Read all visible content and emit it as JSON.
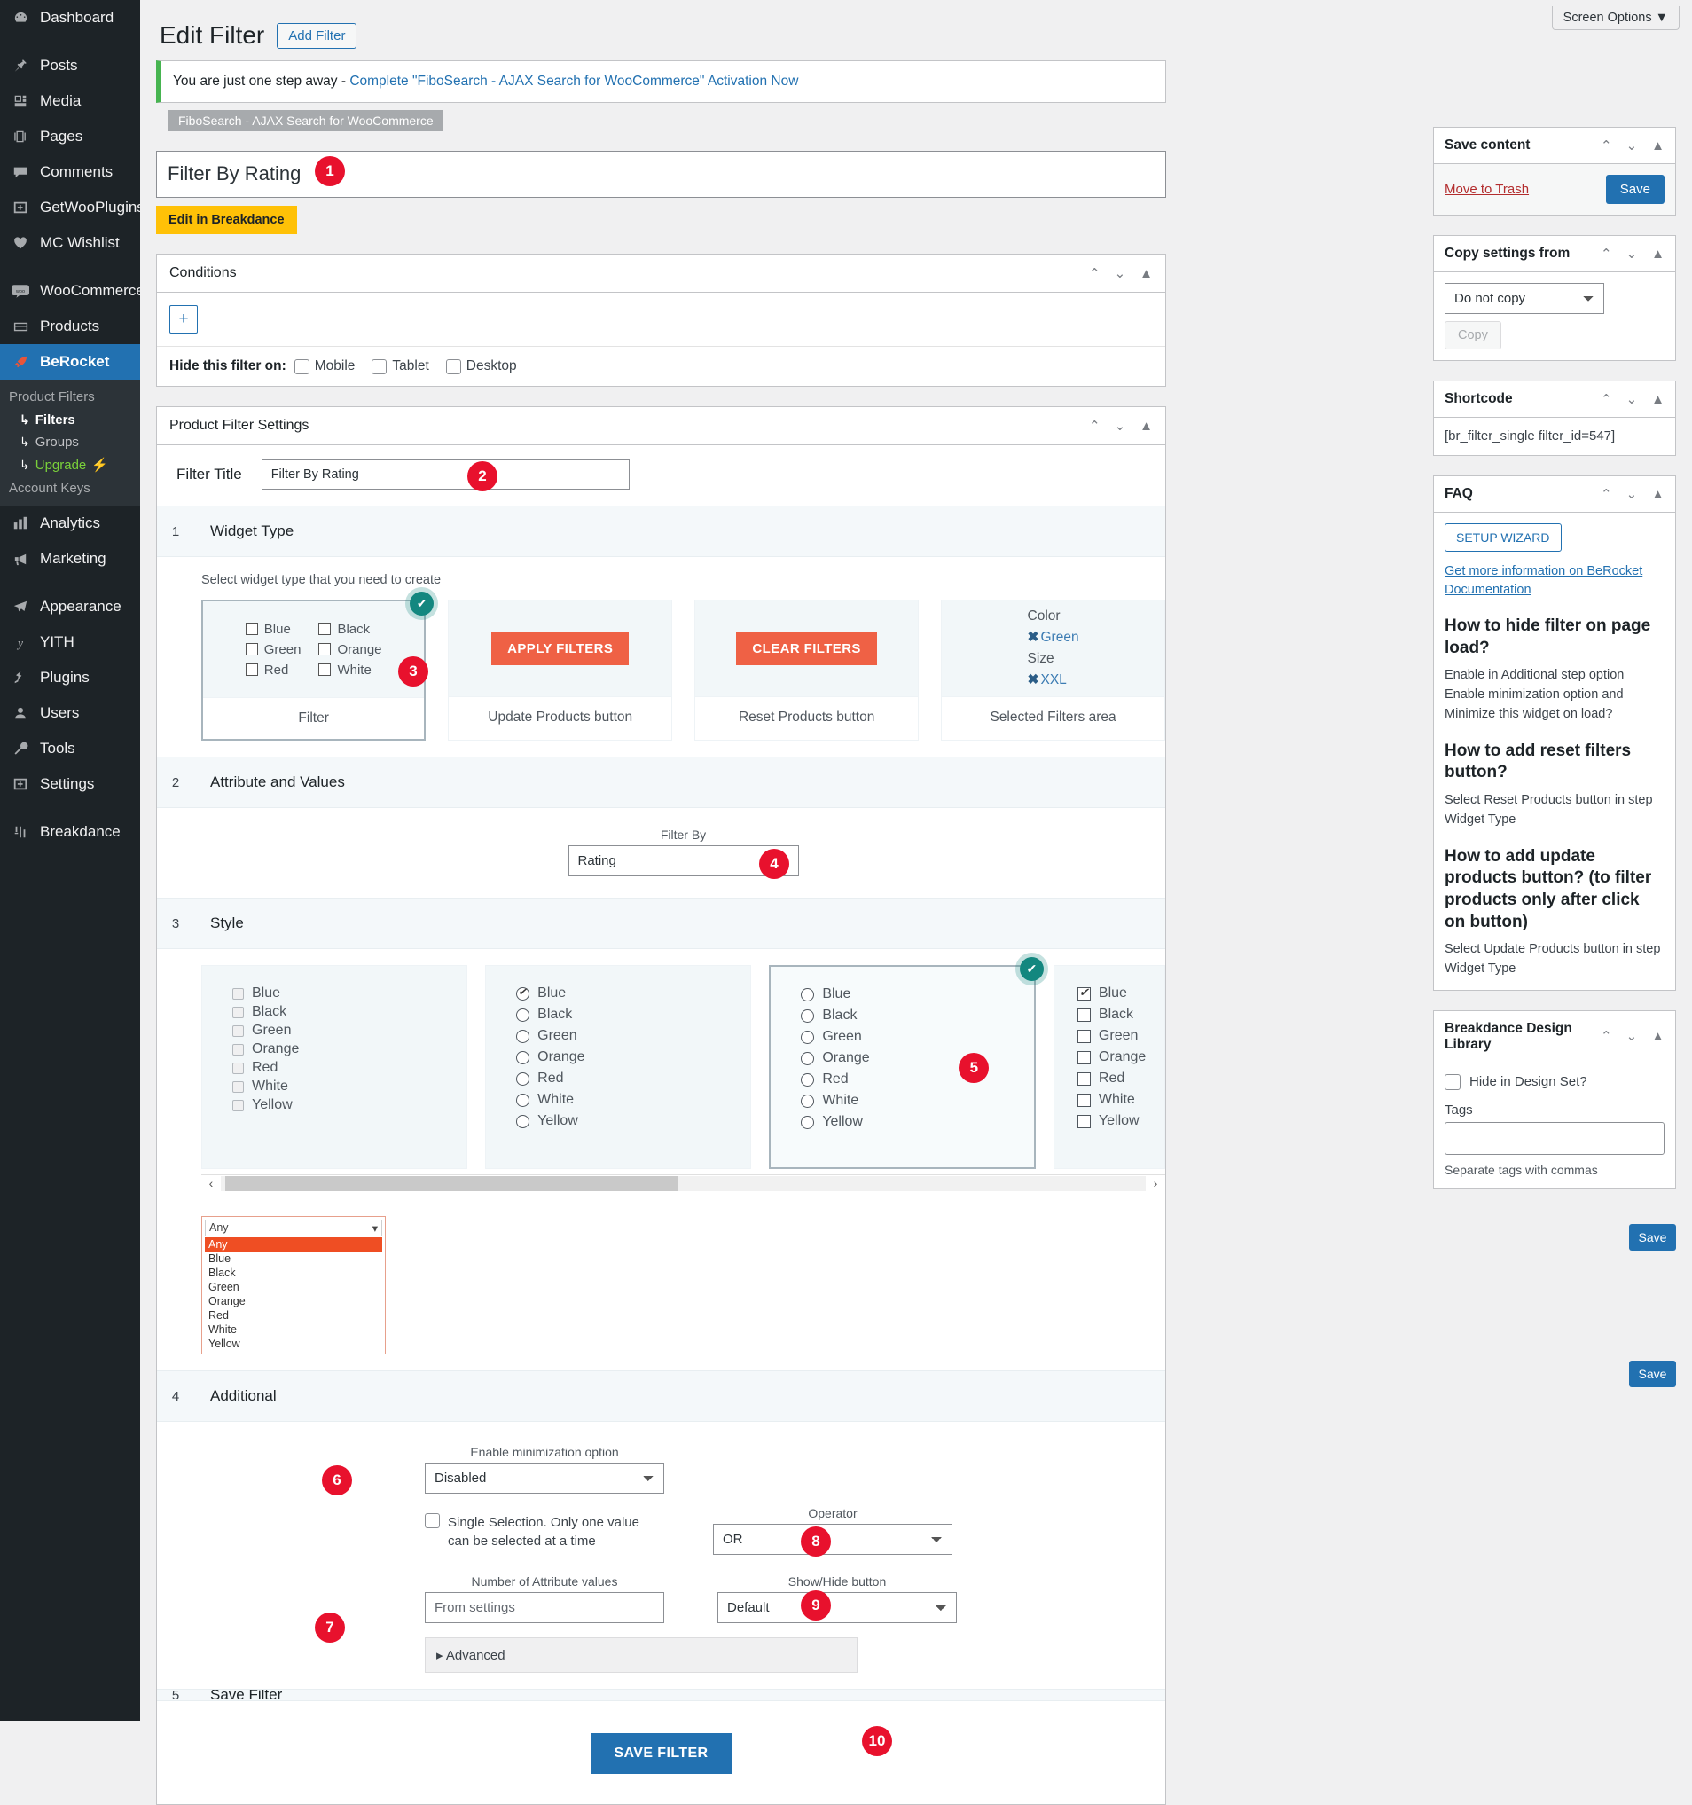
{
  "sidebar": {
    "items": [
      {
        "label": "Dashboard",
        "icon": "dashboard-icon"
      },
      {
        "label": "Posts",
        "icon": "pin-icon"
      },
      {
        "label": "Media",
        "icon": "media-icon"
      },
      {
        "label": "Pages",
        "icon": "pages-icon"
      },
      {
        "label": "Comments",
        "icon": "comments-icon"
      },
      {
        "label": "GetWooPlugins",
        "icon": "plugin-icon"
      },
      {
        "label": "MC Wishlist",
        "icon": "heart-icon"
      },
      {
        "label": "WooCommerce",
        "icon": "woo-icon"
      },
      {
        "label": "Products",
        "icon": "products-icon"
      },
      {
        "label": "BeRocket",
        "icon": "rocket-icon"
      }
    ],
    "submenu": {
      "heading": "Product Filters",
      "items": [
        {
          "label": "Filters",
          "state": "active"
        },
        {
          "label": "Groups",
          "state": "normal"
        },
        {
          "label": "Upgrade",
          "state": "upgrade",
          "suffix": "⚡"
        }
      ],
      "footer": "Account Keys"
    },
    "items_after": [
      {
        "label": "Analytics",
        "icon": "analytics-icon"
      },
      {
        "label": "Marketing",
        "icon": "marketing-icon"
      },
      {
        "label": "Appearance",
        "icon": "appearance-icon"
      },
      {
        "label": "YITH",
        "icon": "yith-icon"
      },
      {
        "label": "Plugins",
        "icon": "plugins-icon"
      },
      {
        "label": "Users",
        "icon": "users-icon"
      },
      {
        "label": "Tools",
        "icon": "tools-icon"
      },
      {
        "label": "Settings",
        "icon": "settings-icon"
      },
      {
        "label": "Breakdance",
        "icon": "breakdance-icon"
      }
    ]
  },
  "header": {
    "screen_options": "Screen Options ▼",
    "title": "Edit Filter",
    "add_filter": "Add Filter"
  },
  "notice": {
    "text": "You are just one step away - ",
    "link": "Complete \"FiboSearch - AJAX Search for WooCommerce\" Activation Now",
    "chip": "FiboSearch - AJAX Search for WooCommerce"
  },
  "title_field": {
    "value": "Filter By Rating",
    "breakdance_button": "Edit in Breakdance"
  },
  "conditions": {
    "heading": "Conditions",
    "add_label": "+",
    "hide_label": "Hide this filter on:",
    "devices": [
      "Mobile",
      "Tablet",
      "Desktop"
    ]
  },
  "settings": {
    "heading": "Product Filter Settings",
    "filter_title_label": "Filter Title",
    "filter_title_value": "Filter By Rating"
  },
  "steps": {
    "widget_type": {
      "num": "1",
      "title": "Widget Type",
      "hint": "Select widget type that you need to create",
      "cards": [
        {
          "caption": "Filter",
          "type": "checkbox-grid",
          "selected": true,
          "options": [
            "Blue",
            "Black",
            "Green",
            "Orange",
            "Red",
            "White"
          ]
        },
        {
          "caption": "Update Products button",
          "type": "button",
          "button_label": "APPLY FILTERS",
          "selected": false
        },
        {
          "caption": "Reset Products button",
          "type": "button",
          "button_label": "CLEAR FILTERS",
          "selected": false
        },
        {
          "caption": "Selected Filters area",
          "type": "selected-filters",
          "selected": false,
          "groups": [
            {
              "name": "Color",
              "chip": "Green"
            },
            {
              "name": "Size",
              "chip": "XXL"
            }
          ],
          "remove_glyph": "✖"
        }
      ]
    },
    "attribute": {
      "num": "2",
      "title": "Attribute and Values",
      "filter_by_label": "Filter By",
      "filter_by_value": "Rating",
      "filter_by_options": [
        "Rating"
      ]
    },
    "style": {
      "num": "3",
      "title": "Style",
      "options": [
        "Blue",
        "Black",
        "Green",
        "Orange",
        "Red",
        "White",
        "Yellow"
      ],
      "cards": [
        {
          "kind": "flat-checkbox",
          "selected": false,
          "checked_index": -1
        },
        {
          "kind": "radio-check",
          "selected": false,
          "checked_index": 0
        },
        {
          "kind": "radio",
          "selected": true,
          "checked_index": -1
        },
        {
          "kind": "checkbox",
          "selected": false,
          "checked_index": 0
        }
      ],
      "dropdown_preview": {
        "selected": "Any",
        "caret": "▾",
        "items": [
          "Any",
          "Blue",
          "Black",
          "Green",
          "Orange",
          "Red",
          "White",
          "Yellow"
        ],
        "highlight_index": 0
      }
    },
    "additional": {
      "num": "4",
      "title": "Additional",
      "minimization_label": "Enable minimization option",
      "minimization_value": "Disabled",
      "minimization_options": [
        "Disabled"
      ],
      "single_selection_text": "Single Selection. Only one value can be selected at a time",
      "operator_label": "Operator",
      "operator_value": "OR",
      "operator_options": [
        "OR"
      ],
      "number_values_label": "Number of Attribute values",
      "number_values_placeholder": "From settings",
      "number_values_value": "",
      "showhide_label": "Show/Hide button",
      "showhide_value": "Default",
      "showhide_options": [
        "Default"
      ],
      "advanced_label": "Advanced",
      "advanced_caret": "▸"
    },
    "save": {
      "num": "5",
      "title": "Save Filter",
      "button": "SAVE FILTER"
    }
  },
  "badges": [
    "1",
    "2",
    "3",
    "4",
    "5",
    "6",
    "7",
    "8",
    "9",
    "10"
  ],
  "sidebar_panels": {
    "save_content": {
      "title": "Save content",
      "trash": "Move to Trash",
      "save": "Save"
    },
    "copy_settings": {
      "title": "Copy settings from",
      "value": "Do not copy",
      "options": [
        "Do not copy"
      ],
      "copy_button": "Copy"
    },
    "shortcode": {
      "title": "Shortcode",
      "value": "[br_filter_single filter_id=547]"
    },
    "faq": {
      "title": "FAQ",
      "wizard_button": "SETUP WIZARD",
      "doc_link": "Get more information on BeRocket Documentation",
      "entries": [
        {
          "q": "How to hide filter on page load?",
          "a": "Enable in Additional step option Enable minimization option and Minimize this widget on load?"
        },
        {
          "q": "How to add reset filters button?",
          "a": "Select Reset Products button in step Widget Type"
        },
        {
          "q": "How to add update products button? (to filter products only after click on button)",
          "a": "Select Update Products button in step Widget Type"
        }
      ]
    },
    "design_library": {
      "title": "Breakdance Design Library",
      "hide_label": "Hide in Design Set?",
      "tags_label": "Tags",
      "tags_value": "",
      "tags_hint": "Separate tags with commas"
    }
  },
  "floating_save": {
    "label": "Save"
  },
  "handle_icons": {
    "up": "⌃",
    "down": "⌄",
    "toggle": "▲"
  },
  "colors": {
    "accent": "#2271b1",
    "orange": "#ef6145",
    "teal": "#13877f",
    "badge": "#e8112d",
    "yellow": "#ffc107"
  }
}
